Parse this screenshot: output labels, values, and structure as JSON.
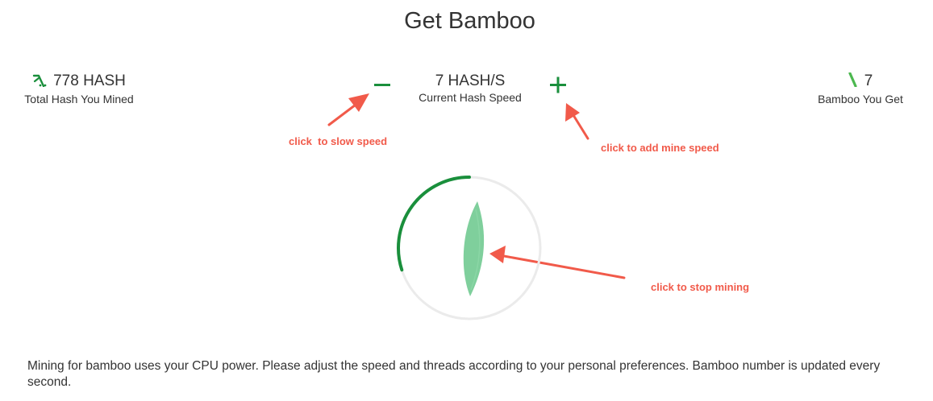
{
  "page": {
    "title": "Get Bamboo"
  },
  "stats": {
    "total_hash": {
      "value": "778 HASH",
      "label": "Total Hash You Mined",
      "icon": "pickaxe-icon"
    },
    "hash_speed": {
      "value": "7 HASH/S",
      "label": "Current Hash Speed"
    },
    "bamboo": {
      "value": "7",
      "label": "Bamboo You Get",
      "icon": "bamboo-icon"
    }
  },
  "controls": {
    "decrease_icon": "minus-icon",
    "increase_icon": "plus-icon"
  },
  "annotations": {
    "slow": "click  to slow speed",
    "add": "click to add mine speed",
    "stop": "click to stop mining"
  },
  "mining": {
    "progress_fraction": 0.3,
    "state": "mining"
  },
  "description": "Mining for bamboo uses your CPU power. Please adjust the speed and threads according to your personal preferences. Bamboo number is updated every second.",
  "colors": {
    "accent_green": "#1a8f3c",
    "leaf_green": "#7fcf9c",
    "annotation_red": "#f15a4a",
    "ring_gray": "#ebebeb"
  }
}
